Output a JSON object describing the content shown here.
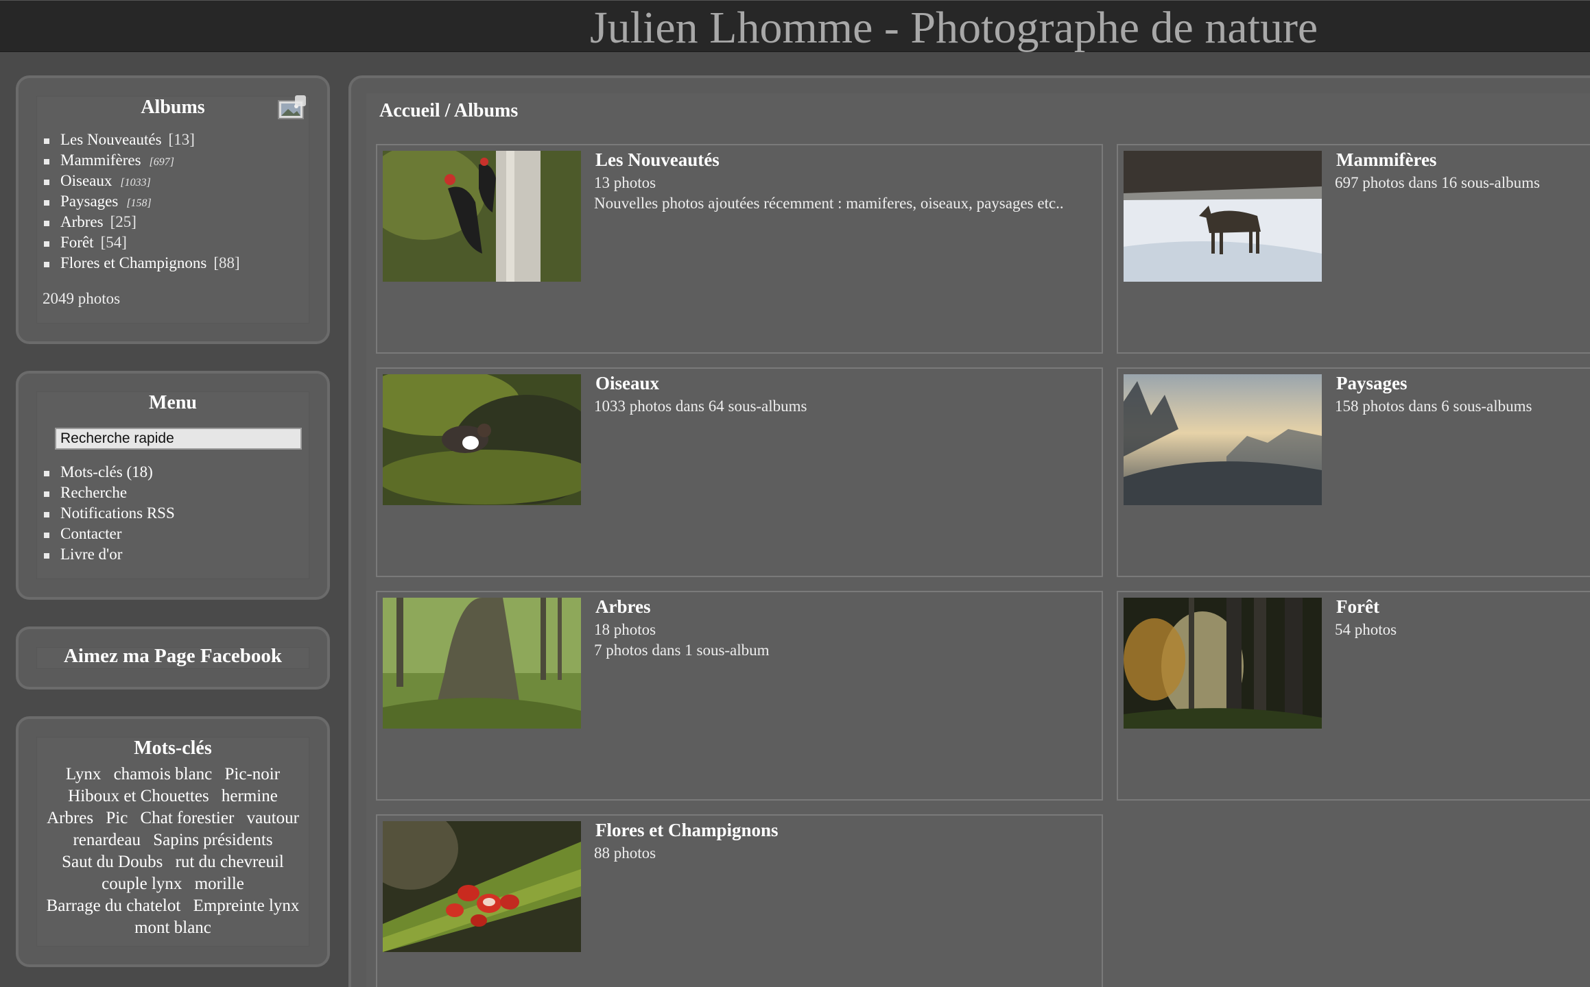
{
  "header": {
    "title": "Julien Lhomme - Photographe de nature"
  },
  "albums_box": {
    "title": "Albums",
    "items": [
      {
        "label": "Les Nouveautés",
        "count": "[13]",
        "italic": false
      },
      {
        "label": "Mammifères",
        "count": "[697]",
        "italic": true
      },
      {
        "label": "Oiseaux",
        "count": "[1033]",
        "italic": true
      },
      {
        "label": "Paysages",
        "count": "[158]",
        "italic": true
      },
      {
        "label": "Arbres",
        "count": "[25]",
        "italic": false
      },
      {
        "label": "Forêt",
        "count": "[54]",
        "italic": false
      },
      {
        "label": "Flores et Champignons",
        "count": "[88]",
        "italic": false
      }
    ],
    "total": "2049 photos",
    "icon": "photo-icon"
  },
  "menu_box": {
    "title": "Menu",
    "search_value": "Recherche rapide",
    "items": [
      "Mots-clés (18)",
      "Recherche",
      "Notifications RSS",
      "Contacter",
      "Livre d'or"
    ]
  },
  "facebook_box": {
    "title": "Aimez ma Page Facebook"
  },
  "tags_box": {
    "title": "Mots-clés",
    "tags": [
      "Lynx",
      "chamois blanc",
      "Pic-noir",
      "Hiboux et Chouettes",
      "hermine",
      "Arbres",
      "Pic",
      "Chat forestier",
      "vautour",
      "renardeau",
      "Sapins présidents",
      "Saut du Doubs",
      "rut du chevreuil",
      "couple lynx",
      "morille",
      "Barrage du chatelot",
      "Empreinte lynx",
      "mont blanc"
    ]
  },
  "main": {
    "breadcrumb": "Accueil / Albums",
    "albums": [
      {
        "title": "Les Nouveautés",
        "lines": [
          "13 photos",
          "Nouvelles photos ajoutées récemment : mamiferes, oiseaux, paysages etc.."
        ]
      },
      {
        "title": "Mammifères",
        "lines": [
          "697 photos dans 16 sous-albums"
        ]
      },
      {
        "title": "Oiseaux",
        "lines": [
          "1033 photos dans 64 sous-albums"
        ]
      },
      {
        "title": "Paysages",
        "lines": [
          "158 photos dans 6 sous-albums"
        ]
      },
      {
        "title": "Arbres",
        "lines": [
          "18 photos",
          "7 photos dans 1 sous-album"
        ]
      },
      {
        "title": "Forêt",
        "lines": [
          "54 photos"
        ]
      },
      {
        "title": "Flores et Champignons",
        "lines": [
          "88 photos"
        ]
      }
    ]
  }
}
